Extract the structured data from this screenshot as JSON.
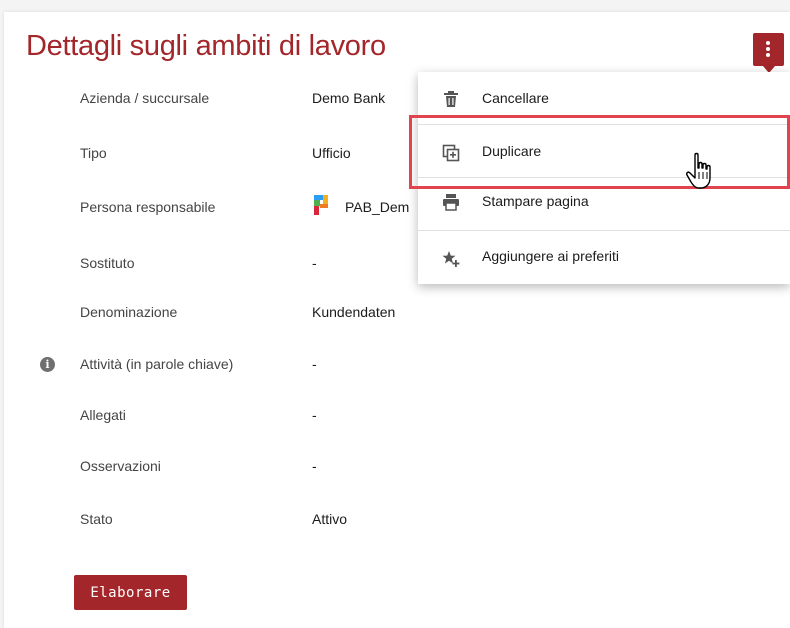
{
  "page": {
    "title": "Dettagli sugli ambiti di lavoro",
    "accent_color": "#a3262a",
    "highlight_color": "#e0444f"
  },
  "header": {
    "menu_button_icon": "kebab-vertical-icon"
  },
  "details": {
    "rows": [
      {
        "label": "Azienda / succursale",
        "value": "Demo Bank"
      },
      {
        "label": "Tipo",
        "value": "Ufficio"
      },
      {
        "label": "Persona responsabile",
        "value": "PAB_Dem"
      },
      {
        "label": "Sostituto",
        "value": "-"
      },
      {
        "label": "Denominazione",
        "value": "Kundendaten"
      },
      {
        "label": "Attività (in parole chiave)",
        "value": "-",
        "icon": "info-icon"
      },
      {
        "label": "Allegati",
        "value": "-"
      },
      {
        "label": "Osservazioni",
        "value": "-"
      },
      {
        "label": "Stato",
        "value": "Attivo"
      }
    ]
  },
  "actions": {
    "edit_label": "Elaborare"
  },
  "menu": {
    "items": [
      {
        "label": "Cancellare",
        "icon": "trash-icon"
      },
      {
        "label": "Duplicare",
        "icon": "duplicate-icon"
      },
      {
        "label": "Stampare pagina",
        "icon": "printer-icon"
      },
      {
        "label": "Aggiungere ai preferiti",
        "icon": "star-add-icon"
      }
    ]
  },
  "cursor": {
    "icon": "hand-pointer-icon"
  }
}
